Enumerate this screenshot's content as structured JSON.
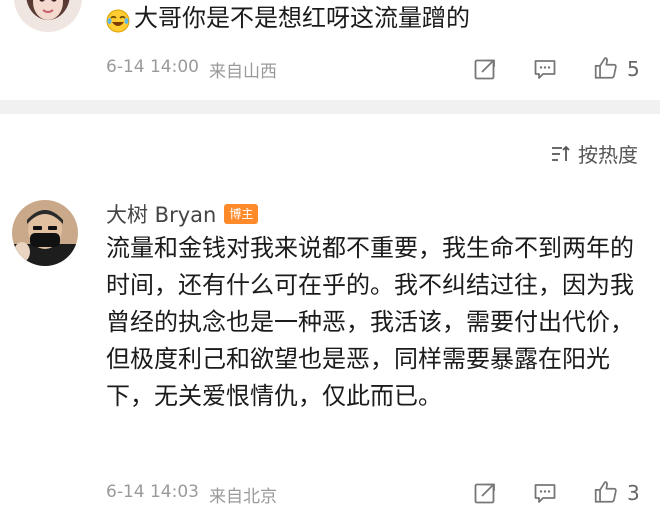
{
  "comment_top": {
    "text": "大哥你是不是想红呀这流量蹭的",
    "time": "6-14 14:00",
    "location": "来自山西",
    "likes": "5"
  },
  "sort": {
    "label": "按热度"
  },
  "comment_bryan": {
    "username": "大树 Bryan",
    "badge": "博主",
    "text": "流量和金钱对我来说都不重要，我生命不到两年的时间，还有什么可在乎的。我不纠结过往，因为我曾经的执念也是一种恶，我活该，需要付出代价，但极度利己和欲望也是恶，同样需要暴露在阳光下，无关爱恨情仇，仅此而已。",
    "time": "6-14 14:03",
    "location": "来自北京",
    "likes": "3"
  }
}
